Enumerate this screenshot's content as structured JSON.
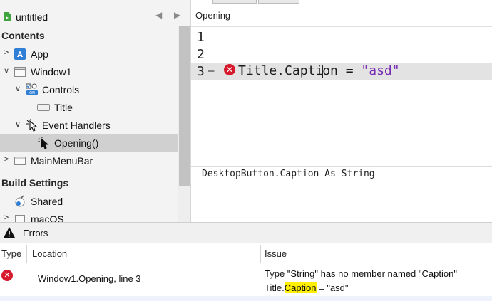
{
  "navigator": {
    "project_name": "untitled",
    "sections": {
      "contents": "Contents",
      "build_settings": "Build Settings"
    },
    "items": [
      {
        "label": "App"
      },
      {
        "label": "Window1"
      },
      {
        "label": "Controls"
      },
      {
        "label": "Title"
      },
      {
        "label": "Event Handlers"
      },
      {
        "label": "Opening()"
      },
      {
        "label": "MainMenuBar"
      },
      {
        "label": "Shared"
      },
      {
        "label": "macOS"
      }
    ],
    "selected": "Opening()"
  },
  "editor": {
    "title": "Opening",
    "line_numbers": [
      "1",
      "2",
      "3"
    ],
    "fold_marker": "—",
    "code": {
      "ident_before_caret": "Title.Capti",
      "ident_after_caret": "on",
      "operator": " = ",
      "string": "\"asd\""
    },
    "tip": "DesktopButton.Caption As String"
  },
  "errors": {
    "title": "Errors",
    "columns": [
      "Type",
      "Location",
      "Issue"
    ],
    "rows": [
      {
        "location": "Window1.Opening, line 3",
        "issue": "Type \"String\" has no member named \"Caption\"",
        "snippet_prefix": "Title.",
        "snippet_highlight": "Caption",
        "snippet_suffix": " = \"asd\""
      }
    ]
  },
  "colors": {
    "error_red": "#d7192d",
    "string_purple": "#7a2db4",
    "highlight_yellow": "#fff000",
    "selection_gray": "#d0d0d0"
  },
  "icons": [
    "project-icon",
    "back-arrow-icon",
    "forward-arrow-icon",
    "app-icon",
    "window-icon",
    "controls-icon",
    "button-control-icon",
    "event-handler-icon",
    "menubar-icon",
    "shared-icon",
    "macos-icon",
    "error-icon",
    "warning-icon"
  ]
}
